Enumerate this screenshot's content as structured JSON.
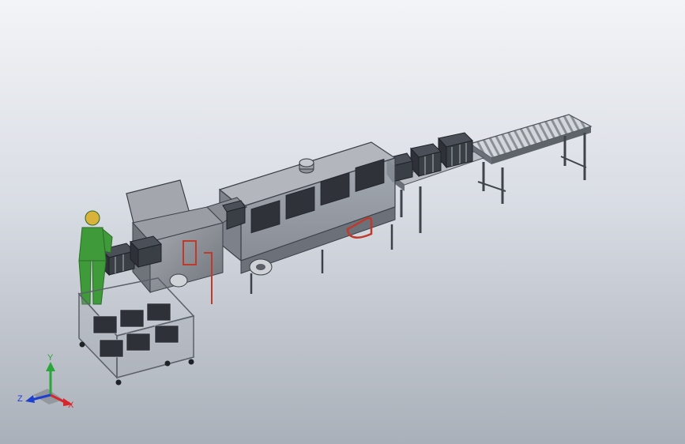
{
  "viewport": {
    "background_top": "#f3f4f7",
    "background_bottom": "#aab0b9"
  },
  "model": {
    "colors": {
      "frame": "#5b6069",
      "machine_body": "#8f9399",
      "conveyor_rollers": "#c7cbd1",
      "operator_green": "#3f9a3a",
      "accent_red": "#c0392b",
      "crate": "#2e3238"
    }
  },
  "triad": {
    "x_label": "X",
    "y_label": "Y",
    "z_label": "Z",
    "x_color": "#d9262a",
    "y_color": "#2aa63a",
    "z_color": "#1f3fcf"
  }
}
